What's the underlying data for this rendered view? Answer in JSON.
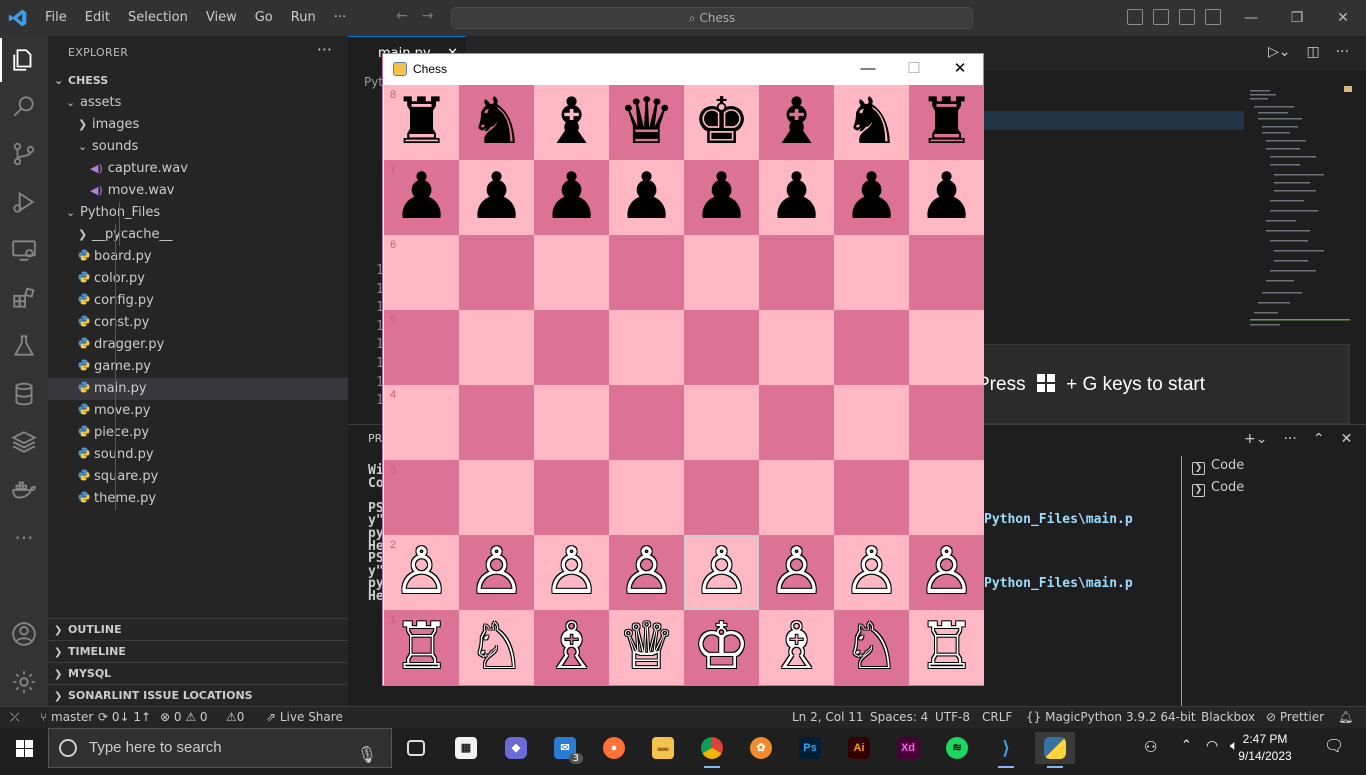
{
  "titlebar": {
    "menu": [
      "File",
      "Edit",
      "Selection",
      "View",
      "Go",
      "Run",
      "···"
    ],
    "search": "Chess"
  },
  "sidebar": {
    "title": "EXPLORER",
    "root": "CHESS",
    "items": [
      {
        "label": "assets",
        "type": "folder-open"
      },
      {
        "label": "images",
        "type": "folder"
      },
      {
        "label": "sounds",
        "type": "folder-open"
      },
      {
        "label": "capture.wav",
        "type": "wav"
      },
      {
        "label": "move.wav",
        "type": "wav"
      },
      {
        "label": "Python_Files",
        "type": "folder-open"
      },
      {
        "label": "__pycache__",
        "type": "folder"
      },
      {
        "label": "board.py",
        "type": "py"
      },
      {
        "label": "color.py",
        "type": "py"
      },
      {
        "label": "config.py",
        "type": "py"
      },
      {
        "label": "const.py",
        "type": "py"
      },
      {
        "label": "dragger.py",
        "type": "py"
      },
      {
        "label": "game.py",
        "type": "py"
      },
      {
        "label": "main.py",
        "type": "py",
        "selected": true
      },
      {
        "label": "move.py",
        "type": "py"
      },
      {
        "label": "piece.py",
        "type": "py"
      },
      {
        "label": "sound.py",
        "type": "py"
      },
      {
        "label": "square.py",
        "type": "py"
      },
      {
        "label": "theme.py",
        "type": "py"
      }
    ],
    "sections": [
      "OUTLINE",
      "TIMELINE",
      "MYSQL",
      "SONARLINT ISSUE LOCATIONS"
    ]
  },
  "editor": {
    "tab": "main.py",
    "breadcrumb_fragment": "Pyt",
    "line_numbers": [
      "1",
      "1",
      "1",
      "1",
      "1",
      "1",
      "1",
      "1"
    ]
  },
  "panel": {
    "tab_fragment": "PRO",
    "terminal_lines": [
      "Wi",
      "Co",
      "",
      "PS",
      "y\"",
      "py",
      "He",
      "PS",
      "y\"",
      "py",
      "He"
    ],
    "path_1": "Python_Files\\main.p",
    "path_2": "Python_Files\\main.p",
    "terminals": [
      "Code",
      "Code"
    ]
  },
  "gamebar": {
    "before": "Press",
    "after": "+ G keys to start"
  },
  "chess": {
    "title": "Chess",
    "ranks": [
      "8",
      "7",
      "6",
      "5",
      "4",
      "3",
      "2",
      "1"
    ],
    "colors": {
      "light": "#feb8c4",
      "dark": "#dc7296"
    },
    "rows": [
      [
        "♜",
        "♞",
        "♝",
        "♛",
        "♚",
        "♝",
        "♞",
        "♜"
      ],
      [
        "♟",
        "♟",
        "♟",
        "♟",
        "♟",
        "♟",
        "♟",
        "♟"
      ],
      [
        "",
        "",
        "",
        "",
        "",
        "",
        "",
        ""
      ],
      [
        "",
        "",
        "",
        "",
        "",
        "",
        "",
        ""
      ],
      [
        "",
        "",
        "",
        "",
        "",
        "",
        "",
        ""
      ],
      [
        "",
        "",
        "",
        "",
        "",
        "",
        "",
        ""
      ],
      [
        "♙",
        "♙",
        "♙",
        "♙",
        "♙",
        "♙",
        "♙",
        "♙"
      ],
      [
        "♖",
        "♘",
        "♗",
        "♕",
        "♔",
        "♗",
        "♘",
        "♖"
      ]
    ]
  },
  "statusbar": {
    "branch": "master",
    "sync": "0↓ 1↑",
    "problems": "⊗ 0 ⚠ 0",
    "ports": "⚠0",
    "liveshare": "Live Share",
    "position": "Ln 2, Col 11",
    "spaces": "Spaces: 4",
    "encoding": "UTF-8",
    "eol": "CRLF",
    "language": "MagicPython",
    "interpreter": "3.9.2 64-bit",
    "theme": "Blackbox",
    "formatter": "Prettier"
  },
  "taskbar": {
    "search_placeholder": "Type here to search",
    "mail_badge": "3",
    "time": "2:47 PM",
    "date": "9/14/2023"
  }
}
